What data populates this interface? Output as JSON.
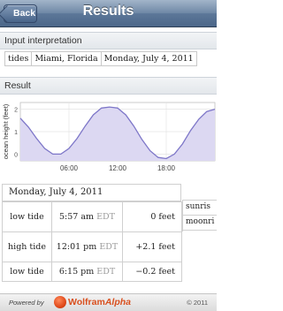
{
  "navbar": {
    "back_label": "Back",
    "title": "Results"
  },
  "input_section": {
    "header": "Input interpretation",
    "tokens": [
      "tides",
      "Miami, Florida",
      "Monday, July 4, 2011"
    ]
  },
  "result_section": {
    "header": "Result"
  },
  "chart_data": {
    "type": "line",
    "ylabel": "ocean height (feet)",
    "xlabel": "",
    "x_ticks": [
      "06:00",
      "12:00",
      "18:00"
    ],
    "y_ticks": [
      "2",
      "1",
      "0"
    ],
    "x": [
      0,
      1,
      2,
      3,
      4,
      5,
      6,
      7,
      8,
      9,
      10,
      11,
      12,
      13,
      14,
      15,
      16,
      17,
      18,
      19,
      20,
      21,
      22,
      23,
      24
    ],
    "series": [
      {
        "values": [
          1.6,
          1.2,
          0.7,
          0.25,
          0.0,
          0.0,
          0.25,
          0.7,
          1.25,
          1.75,
          2.05,
          2.1,
          2.05,
          1.75,
          1.25,
          0.65,
          0.15,
          -0.15,
          -0.2,
          0.0,
          0.45,
          1.05,
          1.55,
          1.9,
          2.0
        ]
      }
    ],
    "ylim": [
      -0.3,
      2.3
    ],
    "xlim": [
      0,
      24
    ],
    "grid": true,
    "fill": "#dcd8f2",
    "line_color": "#7d76c8"
  },
  "tides": {
    "date": "Monday, July 4, 2011",
    "rows": [
      {
        "type": "low tide",
        "time": "5:57 am",
        "tz": "EDT",
        "height": "0 feet"
      },
      {
        "type": "high tide",
        "time": "12:01 pm",
        "tz": "EDT",
        "height": "+2.1 feet"
      },
      {
        "type": "low tide",
        "time": "6:15 pm",
        "tz": "EDT",
        "height": "−0.2 feet"
      }
    ],
    "side_labels": [
      "sunris",
      "moonri"
    ]
  },
  "footer": {
    "powered_by": "Powered by",
    "brand_main": "Wolfram",
    "brand_accent": "Alpha",
    "copyright": "© 2011"
  }
}
